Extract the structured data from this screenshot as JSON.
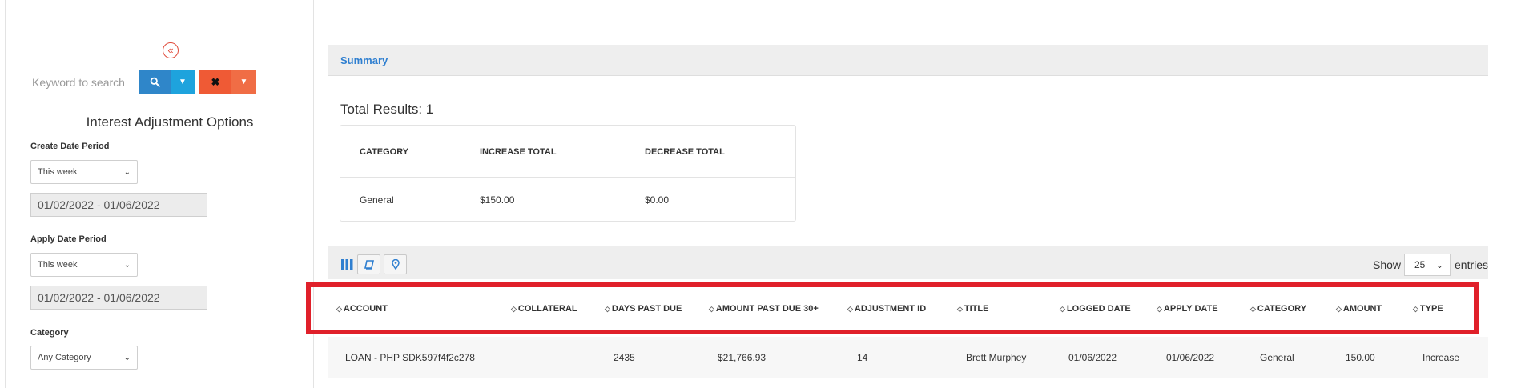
{
  "sidebar": {
    "collapse_glyph": "«",
    "search_placeholder": "Keyword to search",
    "options_title": "Interest Adjustment Options",
    "create_date_label": "Create Date Period",
    "create_date_select": "This week",
    "create_date_range": "01/02/2022 - 01/06/2022",
    "apply_date_label": "Apply Date Period",
    "apply_date_select": "This week",
    "apply_date_range": "01/02/2022 - 01/06/2022",
    "category_label": "Category",
    "category_select": "Any Category"
  },
  "summary": {
    "tab_label": "Summary",
    "total_results": "Total Results: 1",
    "columns": [
      "CATEGORY",
      "INCREASE TOTAL",
      "DECREASE TOTAL"
    ],
    "row": [
      "General",
      "$150.00",
      "$0.00"
    ]
  },
  "table": {
    "show_label": "Show",
    "entries_value": "25",
    "entries_label": "entries",
    "columns": [
      "ACCOUNT",
      "COLLATERAL",
      "DAYS PAST DUE",
      "AMOUNT PAST DUE 30+",
      "ADJUSTMENT ID",
      "TITLE",
      "LOGGED DATE",
      "APPLY DATE",
      "CATEGORY",
      "AMOUNT",
      "TYPE"
    ],
    "rows": [
      [
        "LOAN - PHP SDK597f4f2c278",
        "",
        "2435",
        "$21,766.93",
        "14",
        "Brett Murphey",
        "01/06/2022",
        "01/06/2022",
        "General",
        "150.00",
        "Increase"
      ]
    ]
  },
  "colors": {
    "accent_blue": "#2f7fd0",
    "search_blue": "#2f86c9",
    "clear_orange": "#ef5a35",
    "highlight_red": "#e0202a"
  },
  "icons": [
    "double-chevron-left-icon",
    "search-icon",
    "caret-down-icon",
    "close-icon",
    "columns-icon",
    "book-icon",
    "map-pin-icon",
    "sort-icon"
  ]
}
